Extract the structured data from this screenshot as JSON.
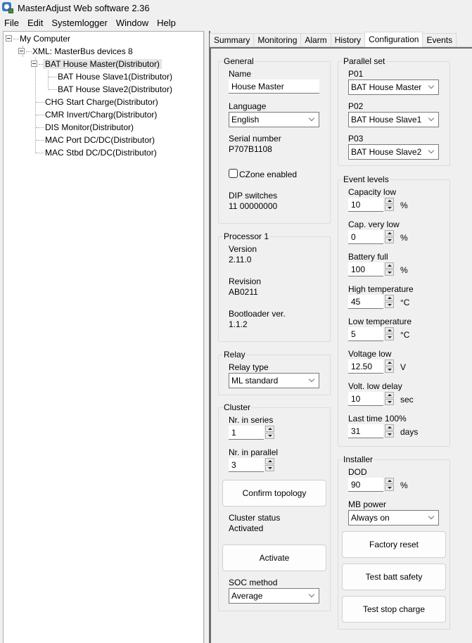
{
  "window": {
    "title": "MasterAdjust Web software 2.36",
    "icon": "masteradjust-app-icon"
  },
  "menu": [
    "File",
    "Edit",
    "Systemlogger",
    "Window",
    "Help"
  ],
  "tree": {
    "root": "My Computer",
    "xml": "XML: MasterBus devices 8",
    "selected": "BAT House Master(Distributor)",
    "children_of_selected": [
      "BAT House Slave1(Distributor)",
      "BAT House Slave2(Distributor)"
    ],
    "others": [
      "CHG Start Charge(Distributor)",
      "CMR Invert/Charg(Distributor)",
      "DIS Monitor(Distributor)",
      "MAC Port DC/DC(Distributor)",
      "MAC Stbd DC/DC(Distributor)"
    ]
  },
  "tabs": [
    {
      "label": "Summary",
      "active": false
    },
    {
      "label": "Monitoring",
      "active": false
    },
    {
      "label": "Alarm",
      "active": false
    },
    {
      "label": "History",
      "active": false
    },
    {
      "label": "Configuration",
      "active": true
    },
    {
      "label": "Events",
      "active": false
    }
  ],
  "general": {
    "title": "General",
    "name_label": "Name",
    "name_value": "House Master",
    "language_label": "Language",
    "language_value": "English",
    "serial_label": "Serial number",
    "serial_value": "P707B1108",
    "czone_label": "CZone enabled",
    "czone_checked": false,
    "dip_label": "DIP switches",
    "dip_value": "11 00000000"
  },
  "processor": {
    "title": "Processor 1",
    "version_label": "Version",
    "version_value": "2.11.0",
    "revision_label": "Revision",
    "revision_value": "AB0211",
    "bootloader_label": "Bootloader ver.",
    "bootloader_value": "1.1.2"
  },
  "relay": {
    "title": "Relay",
    "type_label": "Relay type",
    "type_value": "ML standard"
  },
  "cluster": {
    "title": "Cluster",
    "series_label": "Nr. in series",
    "series_value": "1",
    "parallel_label": "Nr. in parallel",
    "parallel_value": "3",
    "confirm_button": "Confirm topology",
    "status_label": "Cluster status",
    "status_value": "Activated",
    "activate_button": "Activate",
    "soc_label": "SOC method",
    "soc_value": "Average"
  },
  "parallel_set": {
    "title": "Parallel set",
    "items": [
      {
        "label": "P01",
        "value": "BAT House Master"
      },
      {
        "label": "P02",
        "value": "BAT House Slave1"
      },
      {
        "label": "P03",
        "value": "BAT House Slave2"
      }
    ]
  },
  "event_levels": {
    "title": "Event levels",
    "items": [
      {
        "label": "Capacity low",
        "value": "10",
        "unit": "%"
      },
      {
        "label": "Cap. very low",
        "value": "0",
        "unit": "%"
      },
      {
        "label": "Battery full",
        "value": "100",
        "unit": "%"
      },
      {
        "label": "High temperature",
        "value": "45",
        "unit": "°C"
      },
      {
        "label": "Low temperature",
        "value": "5",
        "unit": "°C"
      },
      {
        "label": "Voltage low",
        "value": "12.50",
        "unit": "V"
      },
      {
        "label": "Volt. low delay",
        "value": "10",
        "unit": "sec"
      },
      {
        "label": "Last time 100%",
        "value": "31",
        "unit": "days"
      }
    ]
  },
  "installer": {
    "title": "Installer",
    "dod_label": "DOD",
    "dod_value": "90",
    "dod_unit": "%",
    "mbpower_label": "MB power",
    "mbpower_value": "Always on",
    "factory_reset_button": "Factory reset",
    "test_batt_safety_button": "Test batt safety",
    "test_stop_charge_button": "Test stop charge"
  }
}
